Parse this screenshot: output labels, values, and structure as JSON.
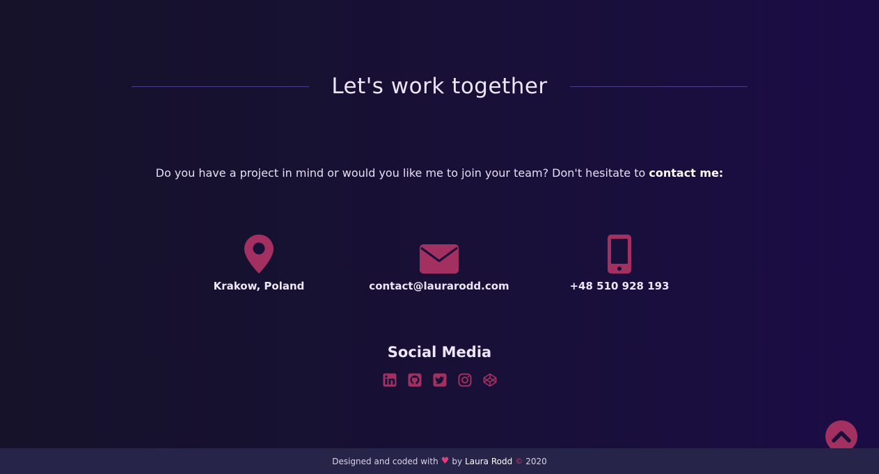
{
  "heading": "Let's work together",
  "intro": {
    "text": "Do you have a project in mind or would you like me to join your team? Don't hesitate to ",
    "bold": "contact me:"
  },
  "contacts": [
    {
      "icon": "map-pin-icon",
      "label": "Krakow, Poland"
    },
    {
      "icon": "envelope-icon",
      "label": "contact@laurarodd.com"
    },
    {
      "icon": "mobile-phone-icon",
      "label": "+48 510 928 193"
    }
  ],
  "social": {
    "title": "Social Media",
    "icons": [
      "linkedin-icon",
      "github-icon",
      "twitter-icon",
      "instagram-icon",
      "codepen-icon"
    ]
  },
  "footer": {
    "prefix": "Designed and coded with",
    "heart": "♥",
    "by": "by",
    "author": "Laura Rodd",
    "copyright": "©",
    "year": "2020"
  },
  "colors": {
    "accent": "#a23060",
    "background": "#181038",
    "footer_bg": "#27244a",
    "text": "#ece6f7"
  }
}
